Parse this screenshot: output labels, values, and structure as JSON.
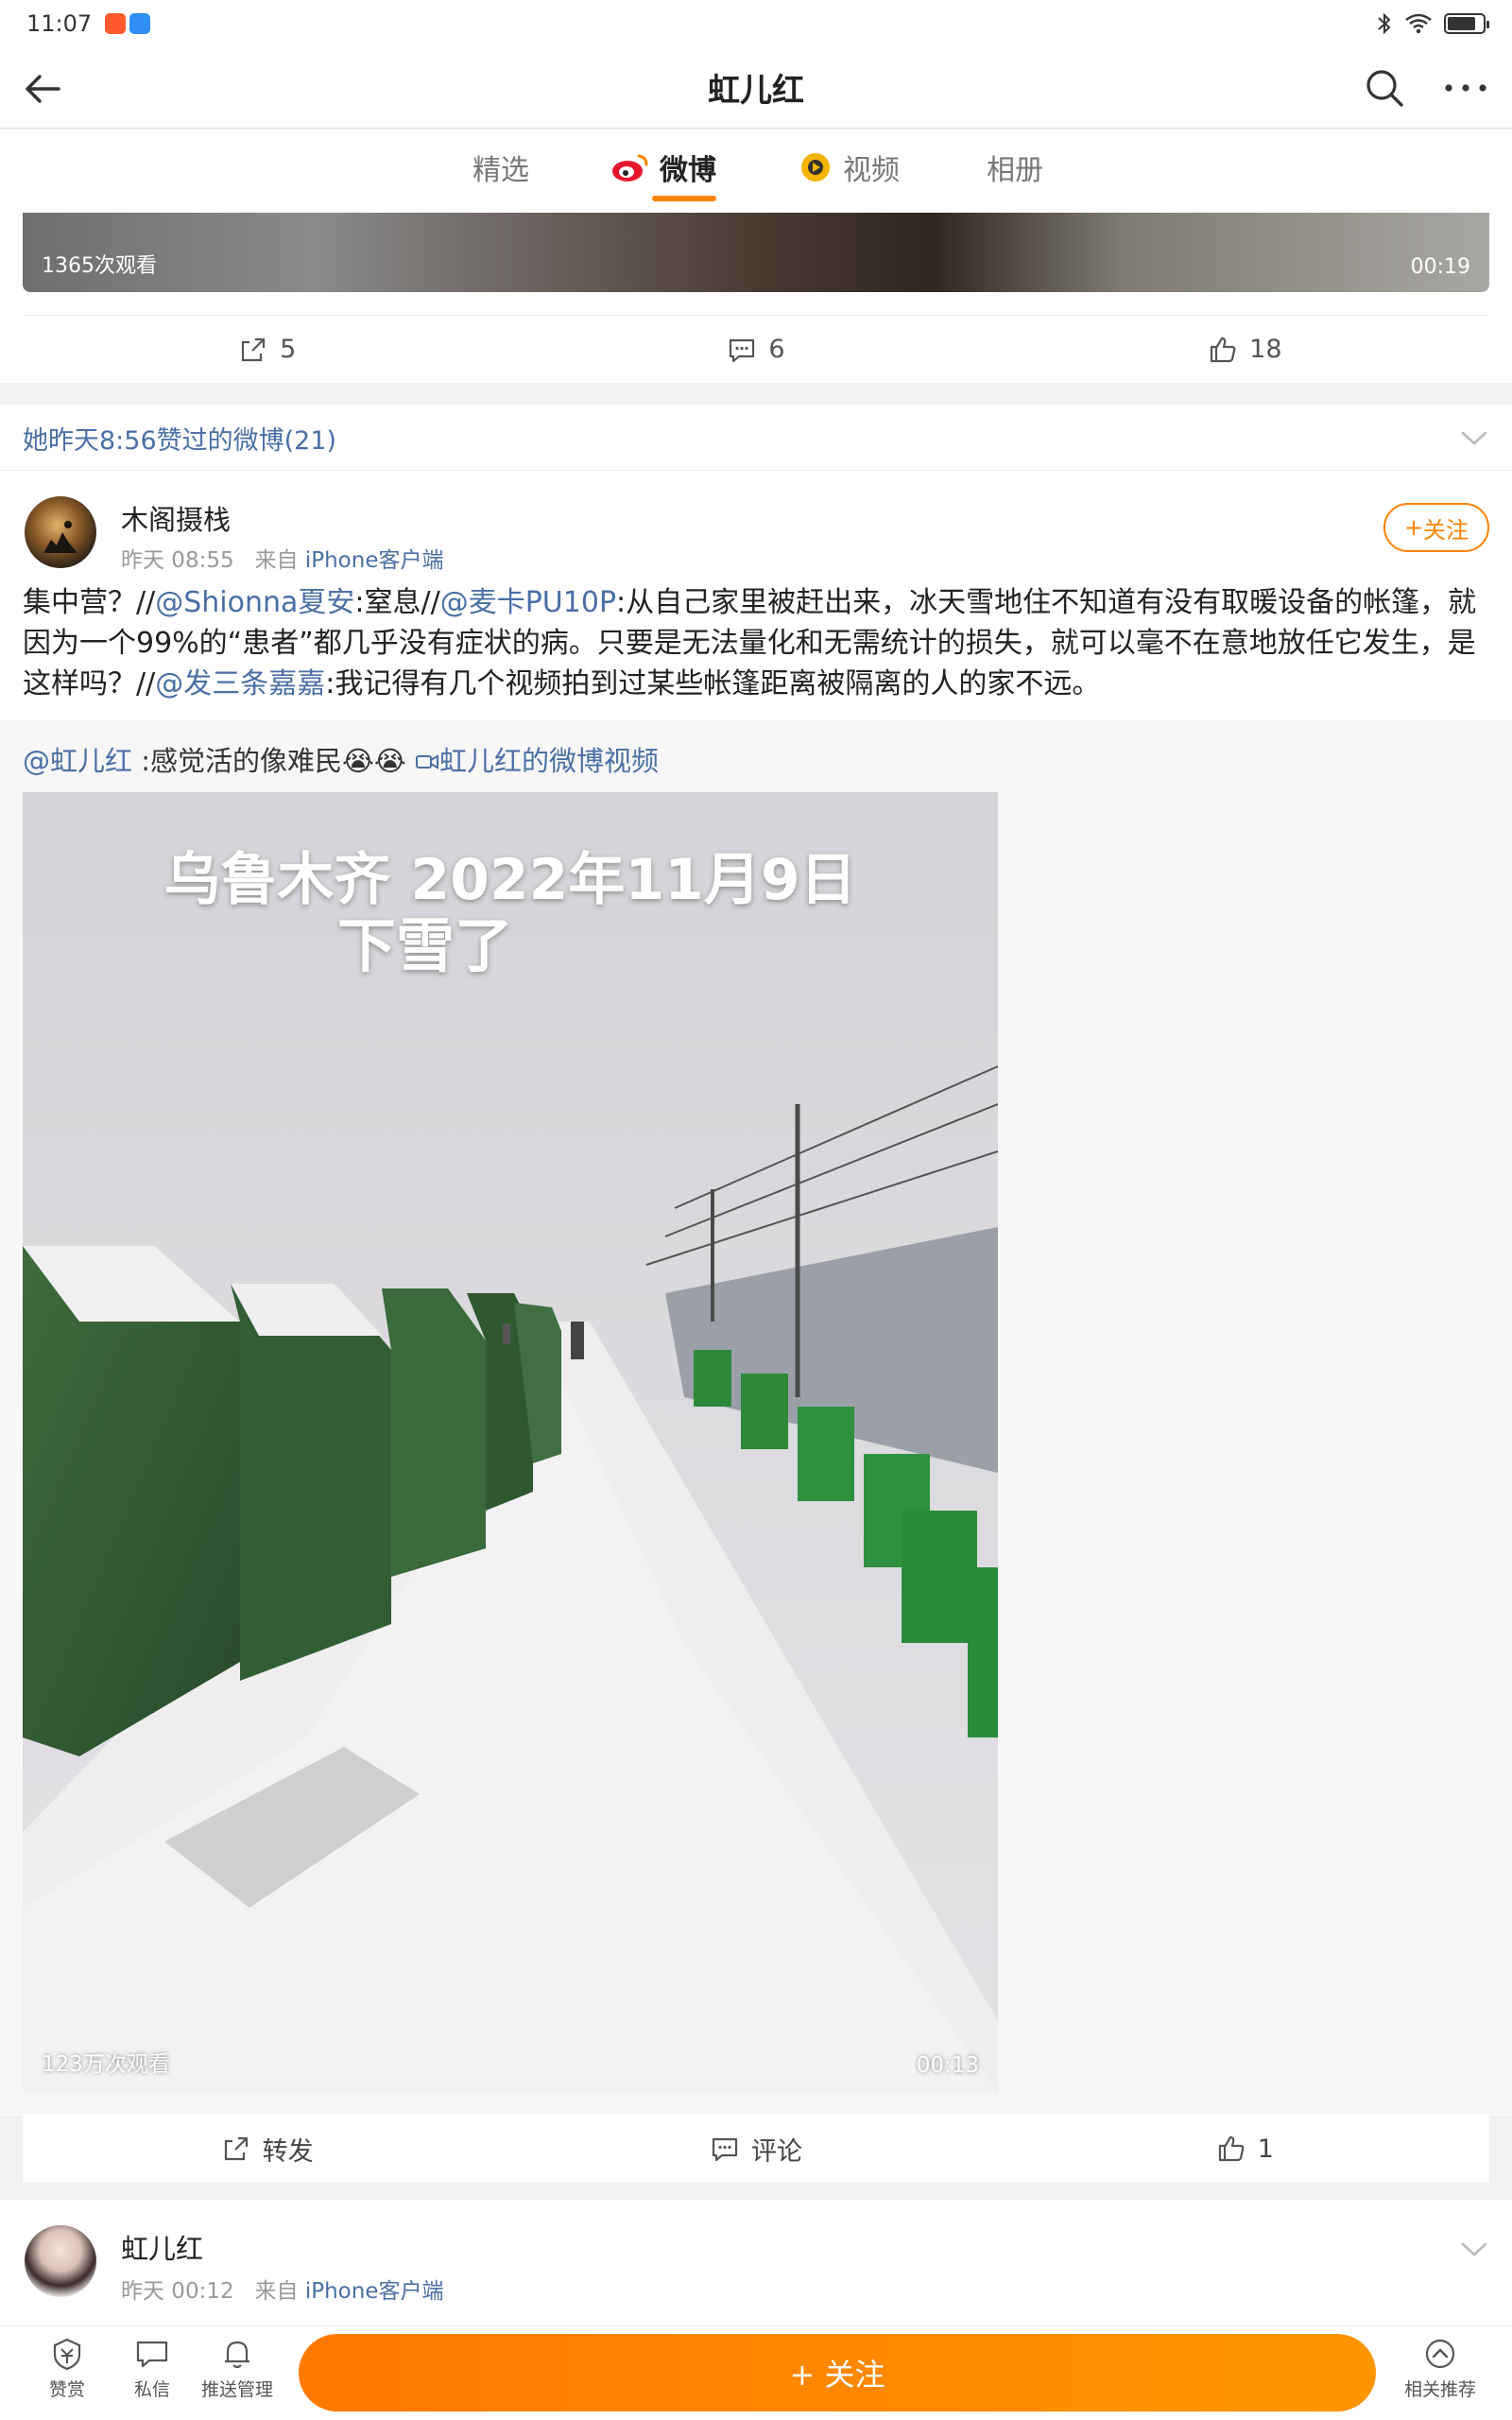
{
  "status_bar": {
    "time": "11:07"
  },
  "header": {
    "title": "虹儿红"
  },
  "tabs": [
    {
      "label": "精选"
    },
    {
      "label": "微博"
    },
    {
      "label": "视频"
    },
    {
      "label": "相册"
    }
  ],
  "prev_post": {
    "video_views": "1365次观看",
    "video_duration": "00:19",
    "repost_count": "5",
    "comment_count": "6",
    "like_count": "18"
  },
  "liked_section": {
    "header": "她昨天8:56赞过的微博(21)"
  },
  "post": {
    "user": "木阁摄栈",
    "time": "昨天 08:55",
    "source_prefix": "来自",
    "source": "iPhone客户端",
    "follow_label": "关注",
    "text_segments": [
      {
        "t": "集中营？//"
      },
      {
        "t": "@Shionna夏安",
        "at": true
      },
      {
        "t": ":窒息//"
      },
      {
        "t": "@麦卡PU10P",
        "at": true
      },
      {
        "t": ":从自己家里被赶出来，冰天雪地住不知道有没有取暖设备的帐篷，就因为一个99%的“患者”都几乎没有症状的病。只要是无法量化和无需统计的损失，就可以毫不在意地放任它发生，是这样吗？//"
      },
      {
        "t": "@发三条嘉嘉",
        "at": true
      },
      {
        "t": ":我记得有几个视频拍到过某些帐篷距离被隔离的人的家不远。"
      }
    ],
    "repost": {
      "author": "@虹儿红",
      "text": ":感觉活的像难民",
      "emoji": "😭😭",
      "video_link": "虹儿红的微博视频",
      "video": {
        "caption_line1": "乌鲁木齐 2022年11月9日",
        "caption_line2": "下雪了",
        "views": "123万次观看",
        "duration": "00:13"
      }
    },
    "actions": {
      "repost_label": "转发",
      "comment_label": "评论",
      "like_count": "1"
    }
  },
  "next_post": {
    "user": "虹儿红",
    "time": "昨天 00:12",
    "source_prefix": "来自",
    "source": "iPhone客户端"
  },
  "footer": {
    "like_label": "赞赏",
    "message_label": "私信",
    "push_label": "推送管理",
    "follow_label": "+ 关注",
    "recommend_label": "相关推荐"
  }
}
